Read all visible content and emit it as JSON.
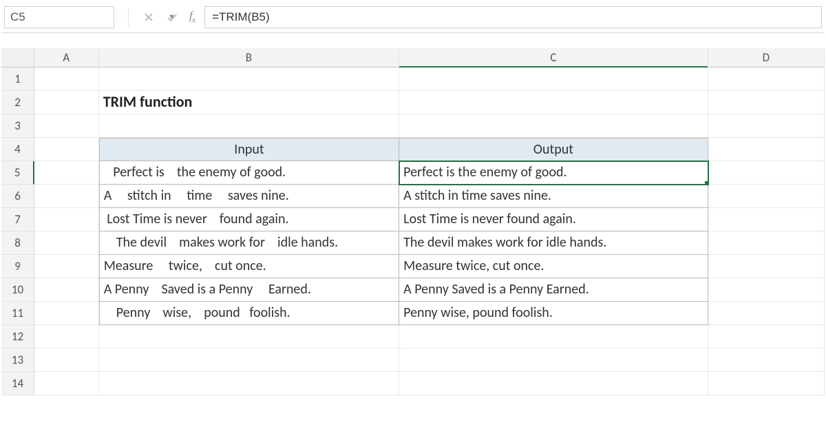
{
  "nameBox": "C5",
  "formula": "=TRIM(B5)",
  "columns": {
    "A": "A",
    "B": "B",
    "C": "C",
    "D": "D"
  },
  "rows": [
    "1",
    "2",
    "3",
    "4",
    "5",
    "6",
    "7",
    "8",
    "9",
    "10",
    "11",
    "12",
    "13",
    "14"
  ],
  "title": "TRIM function",
  "table": {
    "headerInput": "Input",
    "headerOutput": "Output",
    "rows": [
      {
        "input": "   Perfect is    the enemy of good.",
        "output": "Perfect is the enemy of good."
      },
      {
        "input": "A     stitch in     time     saves nine.",
        "output": "A stitch in time saves nine."
      },
      {
        "input": " Lost Time is never    found again.",
        "output": "Lost Time is never found again."
      },
      {
        "input": "    The devil    makes work for    idle hands.",
        "output": "The devil makes work for idle hands."
      },
      {
        "input": "Measure     twice,    cut once.",
        "output": "Measure twice, cut once."
      },
      {
        "input": "A Penny    Saved is a Penny     Earned.",
        "output": "A Penny Saved is a Penny Earned."
      },
      {
        "input": "    Penny    wise,    pound   foolish.",
        "output": "Penny wise, pound foolish."
      }
    ]
  },
  "selectedCell": "C5"
}
